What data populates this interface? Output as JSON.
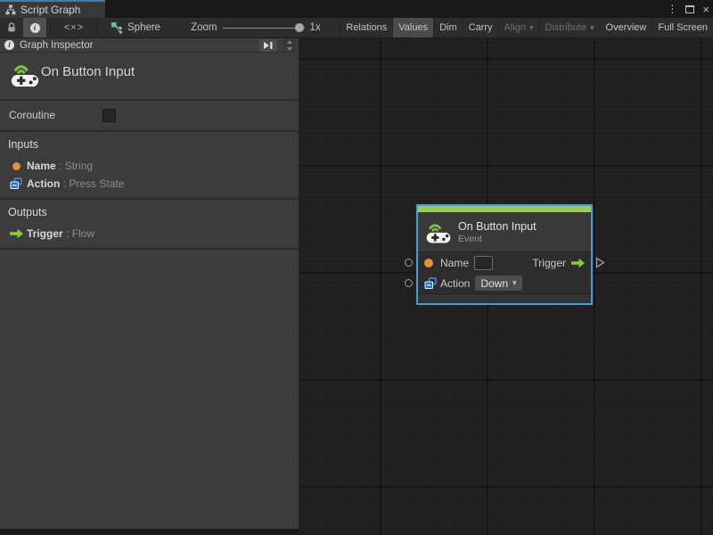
{
  "window": {
    "tab_title": "Script Graph"
  },
  "icons": {
    "menu_dots": "⋮",
    "close": "×",
    "caret_down": "▾",
    "code_glyph": "<×>",
    "info_glyph": "i"
  },
  "toolbar": {
    "target_label": "Sphere",
    "zoom_label": "Zoom",
    "zoom_value": "1x",
    "buttons": [
      {
        "label": "Relations",
        "state": "normal"
      },
      {
        "label": "Values",
        "state": "active"
      },
      {
        "label": "Dim",
        "state": "normal"
      },
      {
        "label": "Carry",
        "state": "normal"
      },
      {
        "label": "Align",
        "state": "disabled",
        "caret": true
      },
      {
        "label": "Distribute",
        "state": "disabled",
        "caret": true
      },
      {
        "label": "Overview",
        "state": "normal"
      },
      {
        "label": "Full Screen",
        "state": "normal"
      }
    ]
  },
  "inspector": {
    "header_title": "Graph Inspector",
    "unit_title": "On Button Input",
    "coroutine_label": "Coroutine",
    "coroutine_checked": false,
    "inputs_title": "Inputs",
    "inputs": [
      {
        "name": "Name",
        "suffix": " : String",
        "icon": "string-port-icon"
      },
      {
        "name": "Action",
        "suffix": " : Press State",
        "icon": "enum-port-icon"
      }
    ],
    "outputs_title": "Outputs",
    "outputs": [
      {
        "name": "Trigger",
        "suffix": " : Flow",
        "icon": "flow-port-icon"
      }
    ]
  },
  "node": {
    "title": "On Button Input",
    "subtitle": "Event",
    "name_label": "Name",
    "name_value": "",
    "trigger_label": "Trigger",
    "action_label": "Action",
    "action_value": "Down"
  },
  "colors": {
    "selection_blue": "#3f9fd6",
    "event_green_bar": "#9ccb52",
    "flow_green": "#86cf35",
    "string_orange": "#e2903c",
    "enum_blue": "#3779d2",
    "tab_accent": "#3b7ebc",
    "panel_bg": "#3c3c3c",
    "canvas_bg": "#212121"
  }
}
